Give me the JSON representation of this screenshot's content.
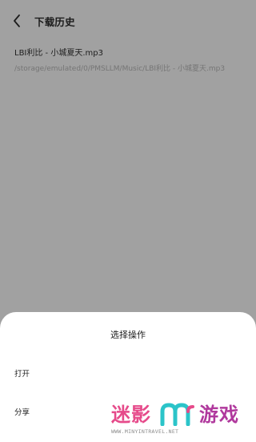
{
  "header": {
    "title": "下载历史"
  },
  "records": [
    {
      "name": "LBI利比 - 小城夏天.mp3",
      "path": "/storage/emulated/0/PMSLLM/Music/LBI利比 - 小城夏天.mp3"
    }
  ],
  "sheet": {
    "title": "选择操作",
    "items": [
      {
        "label": "打开"
      },
      {
        "label": "分享"
      }
    ]
  },
  "watermark": {
    "brand_left": "迷影",
    "brand_right": "游戏",
    "url": "WWW.MINYINTRAVEL.NET"
  },
  "colors": {
    "dim_overlay": "#a1a1a1",
    "sheet_bg": "#ffffff",
    "watermark_pink": "#e64a8a",
    "watermark_teal": "#2bc4c9",
    "watermark_purple": "#b0399d"
  },
  "icons": {
    "back": "chevron-left-icon",
    "logo": "mm-logo"
  }
}
